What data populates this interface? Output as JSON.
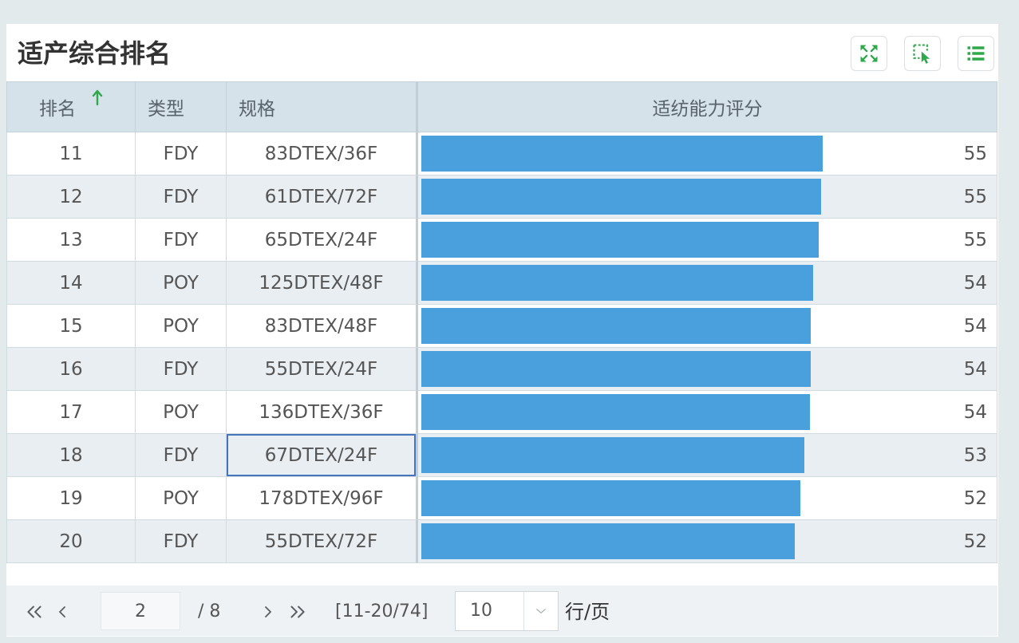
{
  "widget": {
    "title": "适产综合排名",
    "toolbar": [
      {
        "icon": "fullscreen-icon"
      },
      {
        "icon": "select-cursor-icon"
      },
      {
        "icon": "list-icon"
      }
    ]
  },
  "colors": {
    "accent_green": "#2ea84a",
    "bar_blue": "#4a9fdd",
    "header_bg": "#d5e2ea",
    "row_alt_bg": "#e9eef3",
    "focus_border": "#4575ba",
    "background": "#e2eaeb"
  },
  "table": {
    "columns": [
      {
        "label": "排名",
        "sort_icon": "arrow-up-icon"
      },
      {
        "label": "类型"
      },
      {
        "label": "规格"
      },
      {
        "label": "适纺能力评分"
      }
    ],
    "rows": [
      {
        "rank": "11",
        "type": "FDY",
        "spec": "83DTEX/36F",
        "score": "55",
        "bar_level_pct": 70.0
      },
      {
        "rank": "12",
        "type": "FDY",
        "spec": "61DTEX/72F",
        "score": "55",
        "bar_level_pct": 69.7
      },
      {
        "rank": "13",
        "type": "FDY",
        "spec": "65DTEX/24F",
        "score": "55",
        "bar_level_pct": 69.2
      },
      {
        "rank": "14",
        "type": "POY",
        "spec": "125DTEX/48F",
        "score": "54",
        "bar_level_pct": 68.3
      },
      {
        "rank": "15",
        "type": "POY",
        "spec": "83DTEX/48F",
        "score": "54",
        "bar_level_pct": 67.9
      },
      {
        "rank": "16",
        "type": "FDY",
        "spec": "55DTEX/24F",
        "score": "54",
        "bar_level_pct": 67.9
      },
      {
        "rank": "17",
        "type": "POY",
        "spec": "136DTEX/36F",
        "score": "54",
        "bar_level_pct": 67.8
      },
      {
        "rank": "18",
        "type": "FDY",
        "spec": "67DTEX/24F",
        "score": "53",
        "bar_level_pct": 66.8,
        "focused": true
      },
      {
        "rank": "19",
        "type": "POY",
        "spec": "178DTEX/96F",
        "score": "52",
        "bar_level_pct": 66.0
      },
      {
        "rank": "20",
        "type": "FDY",
        "spec": "55DTEX/72F",
        "score": "52",
        "bar_level_pct": 65.1
      }
    ]
  },
  "pagination": {
    "first_icon": "double-chevron-left-icon",
    "prev_icon": "chevron-left-icon",
    "current_page": "2",
    "total_pages_text": "/ 8",
    "next_icon": "chevron-right-icon",
    "last_icon": "double-chevron-right-icon",
    "range_text": "[11-20/74]",
    "page_size": "10",
    "page_size_icon": "chevron-down-icon",
    "page_size_unit": "行/页"
  }
}
